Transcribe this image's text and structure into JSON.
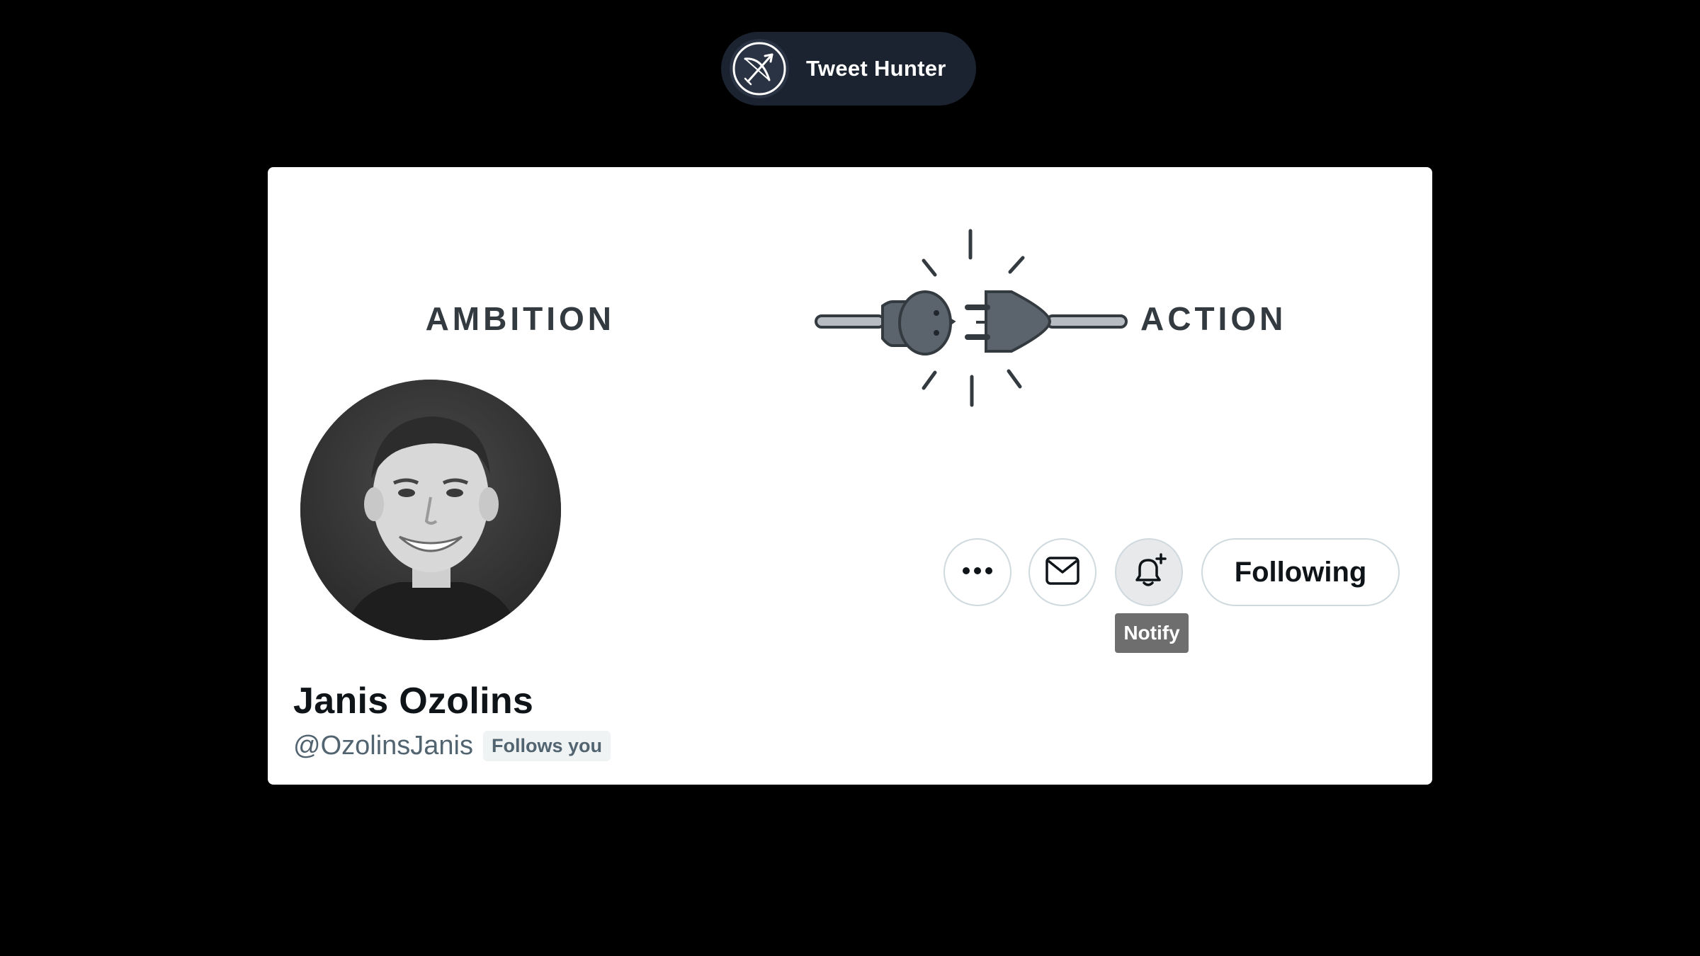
{
  "brand": {
    "name": "Tweet Hunter",
    "logo_icon": "bow-and-arrow-icon"
  },
  "banner": {
    "left_word": "AMBITION",
    "right_word": "ACTION",
    "icon": "plug-and-socket-icon"
  },
  "profile": {
    "display_name": "Janis Ozolins",
    "handle": "@OzolinsJanis",
    "follows_you_badge": "Follows you",
    "avatar_icon": "profile-photo"
  },
  "actions": {
    "more_icon": "more-options-icon",
    "message_icon": "mail-icon",
    "notify_icon": "bell-plus-icon",
    "following_label": "Following",
    "notify_tooltip": "Notify"
  },
  "colors": {
    "page_background": "#000000",
    "brand_pill": "#1b2230",
    "card_background": "#ffffff",
    "text_primary": "#0f1419",
    "text_secondary": "#536471",
    "button_border": "#cfd9de",
    "tooltip_background": "#6e6e6e"
  }
}
